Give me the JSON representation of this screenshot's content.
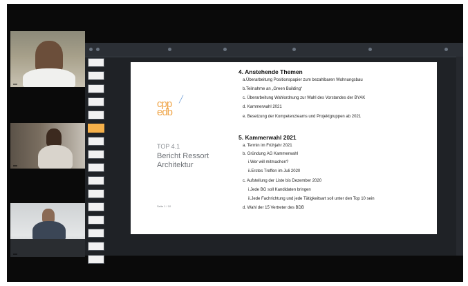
{
  "videos": [
    {
      "name": ""
    },
    {
      "name": ""
    },
    {
      "name": ""
    }
  ],
  "slide": {
    "logo_text": "cpp\nedb",
    "top_label": "TOP 4.1",
    "title": "Bericht Ressort Architektur",
    "footer_line": "",
    "page_number": "Seite 1 / 10",
    "section4": {
      "title": "4. Anstehende Themen",
      "items": [
        "a.Überarbeitung Positionspapier zum bezahlbaren Wohnungsbau",
        "b.Teilnahme an „Green Building“",
        "c. Überarbeitung Wahlordnung zur Wahl des Vorstandes der BYAK",
        "d. Kammerwahl 2021",
        "e. Besetzung der Kompetenzteams und Projektgruppen ab 2021"
      ]
    },
    "section5": {
      "title": "5. Kammerwahl 2021",
      "items": [
        "a. Termin im Frühjahr 2021",
        "b. Gründung AG Kammerwahl",
        "i.Wer will mitmachen?",
        "ii.Erstes Treffen im Juli 2020",
        "c. Aufstellung der Liste bis Dezember 2020",
        "i.Jede BG soll Kandidaten bringen",
        "ii.Jede Fachrichtung und jede Tätigkeitsart soll unter den Top 10 sein",
        "d. Wahl der 15 Vertreter des BDB"
      ]
    }
  }
}
